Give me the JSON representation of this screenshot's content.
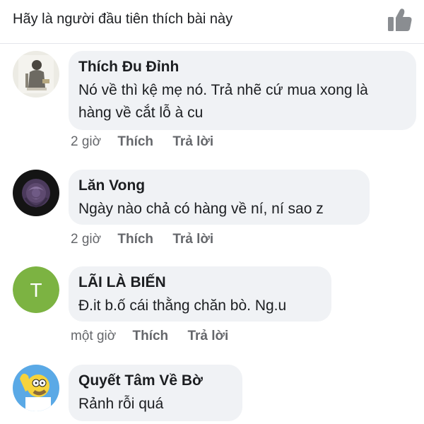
{
  "header": {
    "prompt": "Hãy là người đầu tiên thích bài này",
    "like_icon": "thumbs-up-icon"
  },
  "comments": [
    {
      "author": "Thích Đu Đỉnh",
      "text": "Nó về thì kệ mẹ nó. Trả nhẽ cứ mua xong là hàng về cắt lỗ à cu",
      "time": "2 giờ",
      "like_label": "Thích",
      "reply_label": "Trả lời"
    },
    {
      "author": "Lăn Vong",
      "text": "Ngày nào chả có hàng về ní, ní sao z",
      "time": "2 giờ",
      "like_label": "Thích",
      "reply_label": "Trả lời"
    },
    {
      "author": "LÃI LÀ BIẾN",
      "avatar_letter": "T",
      "avatar_color": "#7cb342",
      "text": "Đ.it b.ố cái thằng chăn bò. Ng.u",
      "time": "một giờ",
      "like_label": "Thích",
      "reply_label": "Trả lời"
    },
    {
      "author": "Quyết Tâm Về Bờ",
      "text": "Rảnh rỗi quá"
    }
  ],
  "colors": {
    "bubble_bg": "#f0f2f5",
    "meta_text": "#65676b",
    "primary_text": "#1c1e21"
  }
}
